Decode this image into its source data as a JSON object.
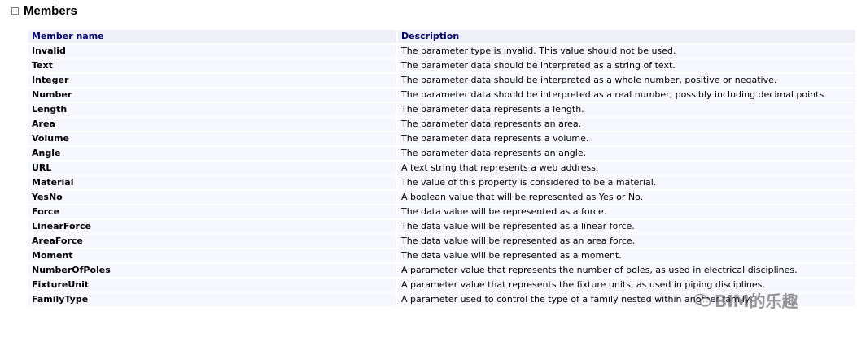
{
  "section": {
    "title": "Members"
  },
  "table": {
    "headers": [
      "Member name",
      "Description"
    ],
    "rows": [
      {
        "name": "Invalid",
        "description": "The parameter type is invalid. This value should not be used."
      },
      {
        "name": "Text",
        "description": "The parameter data should be interpreted as a string of text."
      },
      {
        "name": "Integer",
        "description": "The parameter data should be interpreted as a whole number, positive or negative."
      },
      {
        "name": "Number",
        "description": "The parameter data should be interpreted as a real number, possibly including decimal points."
      },
      {
        "name": "Length",
        "description": "The parameter data represents a length."
      },
      {
        "name": "Area",
        "description": "The parameter data represents an area."
      },
      {
        "name": "Volume",
        "description": "The parameter data represents a volume."
      },
      {
        "name": "Angle",
        "description": "The parameter data represents an angle."
      },
      {
        "name": "URL",
        "description": "A text string that represents a web address."
      },
      {
        "name": "Material",
        "description": "The value of this property is considered to be a material."
      },
      {
        "name": "YesNo",
        "description": "A boolean value that will be represented as Yes or No."
      },
      {
        "name": "Force",
        "description": "The data value will be represented as a force."
      },
      {
        "name": "LinearForce",
        "description": "The data value will be represented as a linear force."
      },
      {
        "name": "AreaForce",
        "description": "The data value will be represented as an area force."
      },
      {
        "name": "Moment",
        "description": "The data value will be represented as a moment."
      },
      {
        "name": "NumberOfPoles",
        "description": "A parameter value that represents the number of poles, as used in electrical disciplines."
      },
      {
        "name": "FixtureUnit",
        "description": "A parameter value that represents the fixture units, as used in piping disciplines."
      },
      {
        "name": "FamilyType",
        "description": "A parameter used to control the type of a family nested within another family."
      }
    ]
  },
  "watermark": {
    "text": "BIM的乐趣",
    "icon": "wechat-icon"
  },
  "colors": {
    "header_bg": "#efeff7",
    "header_text": "#000066",
    "row_bg": "#f7f7ff"
  }
}
